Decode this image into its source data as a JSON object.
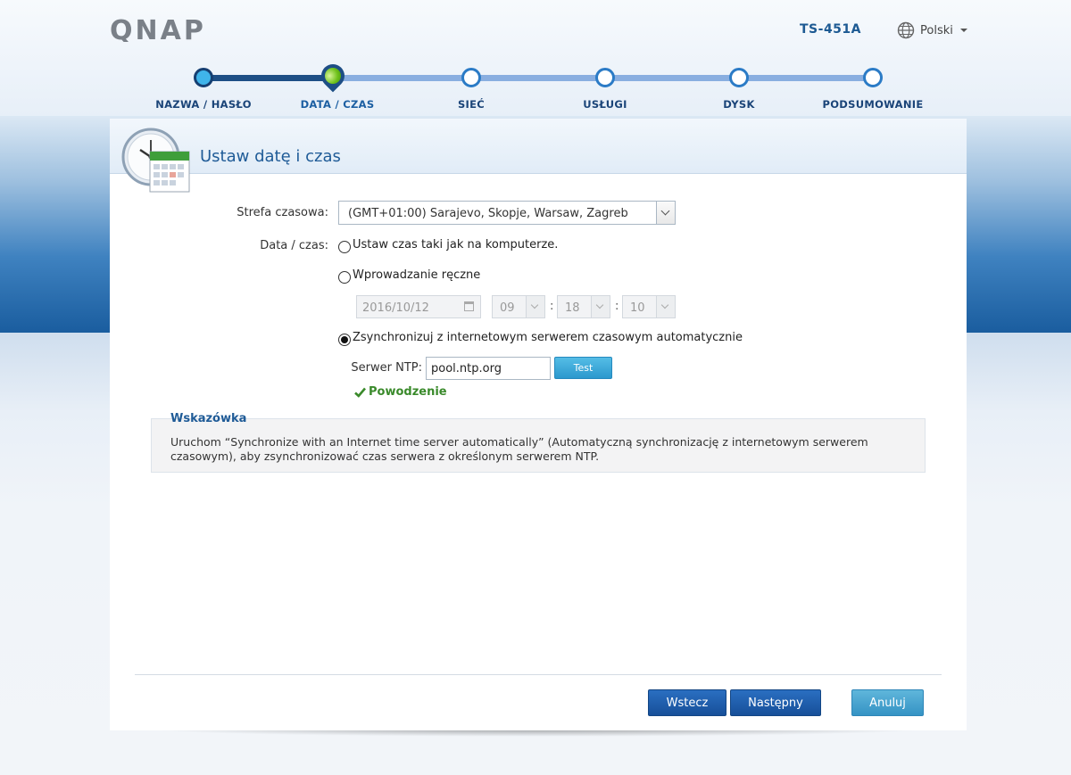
{
  "header": {
    "logo_text": "QNAP",
    "model": "TS-451A",
    "language": "Polski"
  },
  "steps": [
    {
      "label": "NAZWA / HASŁO",
      "state": "done"
    },
    {
      "label": "DATA / CZAS",
      "state": "current"
    },
    {
      "label": "SIEĆ",
      "state": "todo"
    },
    {
      "label": "USŁUGI",
      "state": "todo"
    },
    {
      "label": "DYSK",
      "state": "todo"
    },
    {
      "label": "PODSUMOWANIE",
      "state": "todo"
    }
  ],
  "panel": {
    "title": "Ustaw datę i czas"
  },
  "form": {
    "timezone_label": "Strefa czasowa:",
    "timezone_value": "(GMT+01:00) Sarajevo, Skopje, Warsaw, Zagreb",
    "datetime_label": "Data / czas:",
    "option_computer": "Ustaw czas taki jak na komputerze.",
    "option_manual": "Wprowadzanie ręczne",
    "manual_date": "2016/10/12",
    "manual_hour": "09",
    "manual_minute": "18",
    "manual_second": "10",
    "time_separator": ":",
    "option_sync": "Zsynchronizuj z internetowym serwerem czasowym automatycznie",
    "selected_option": "sync",
    "ntp_label": "Serwer NTP:",
    "ntp_value": "pool.ntp.org",
    "test_button": "Test",
    "success_text": "Powodzenie"
  },
  "hint": {
    "title": "Wskazówka",
    "text": "Uruchom “Synchronize with an Internet time server automatically” (Automatyczną synchronizację z internetowym serwerem czasowym), aby zsynchronizować czas serwera z określonym serwerem NTP."
  },
  "buttons": {
    "back": "Wstecz",
    "next": "Następny",
    "cancel": "Anuluj"
  },
  "colors": {
    "brand_blue": "#1f5b97",
    "success_green": "#3a8a2b",
    "button_primary": "#174f99",
    "button_cancel": "#3593c4"
  }
}
